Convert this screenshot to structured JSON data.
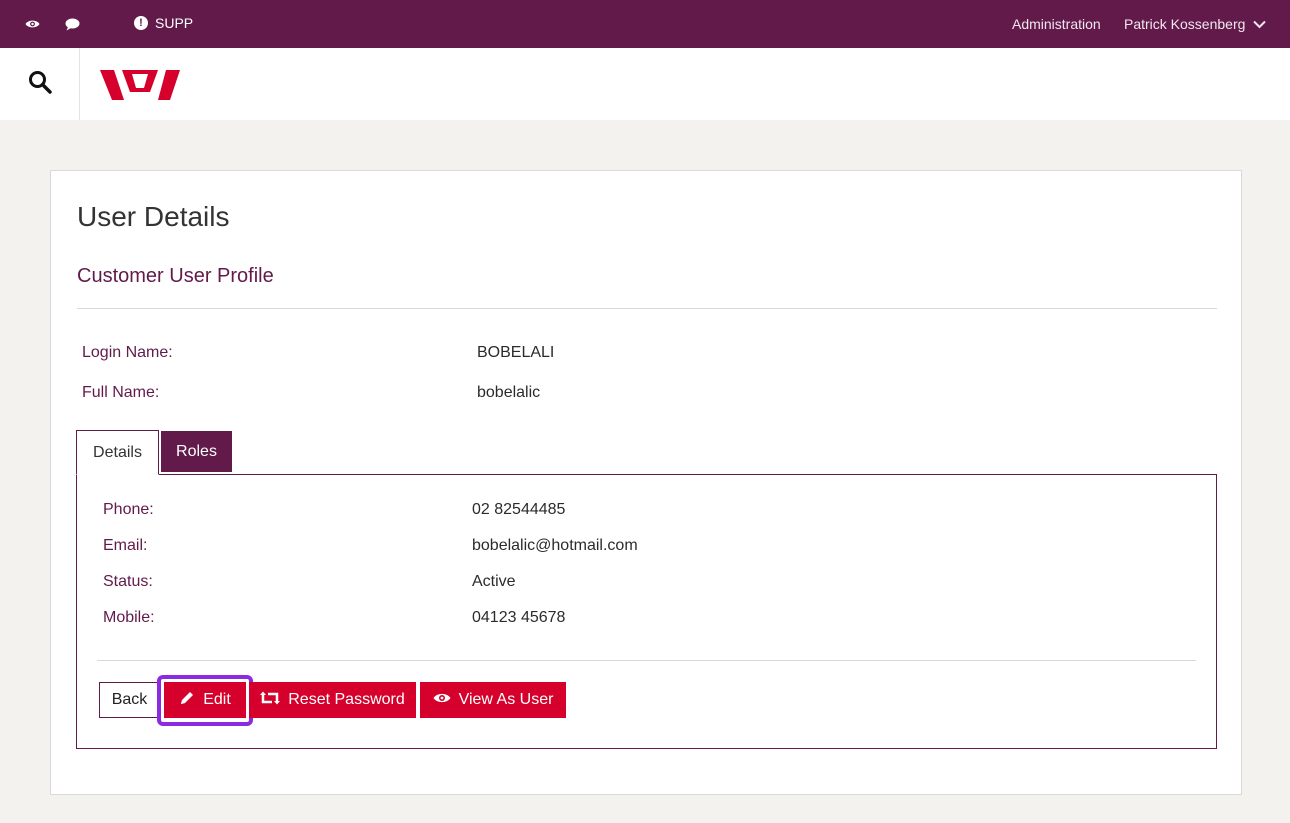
{
  "topbar": {
    "supp_label": "SUPP",
    "administration_label": "Administration",
    "user_name": "Patrick Kossenberg"
  },
  "page": {
    "title": "User Details",
    "subtitle": "Customer User Profile"
  },
  "profile": {
    "login_name_label": "Login Name:",
    "login_name_value": "BOBELALI",
    "full_name_label": "Full Name:",
    "full_name_value": "bobelalic"
  },
  "tabs": {
    "details_label": "Details",
    "roles_label": "Roles",
    "active": "Details"
  },
  "details": [
    {
      "label": "Phone:",
      "value": "02 82544485"
    },
    {
      "label": "Email:",
      "value": "bobelalic@hotmail.com"
    },
    {
      "label": "Status:",
      "value": "Active"
    },
    {
      "label": "Mobile:",
      "value": "04123 45678"
    }
  ],
  "actions": {
    "back_label": "Back",
    "edit_label": "Edit",
    "reset_password_label": "Reset Password",
    "view_as_user_label": "View As User"
  },
  "colors": {
    "brand_plum": "#621a4b",
    "brand_red": "#d5002b",
    "focus_outline": "#8a2be2",
    "page_background": "#f3f2ef"
  },
  "icons": {
    "eye": "eye-icon",
    "comment": "comment-icon",
    "alert": "exclamation-circle-icon",
    "chevron": "chevron-down-icon",
    "search": "search-icon",
    "pencil": "pencil-icon",
    "retweet": "refresh-icon",
    "view": "eye-icon"
  }
}
